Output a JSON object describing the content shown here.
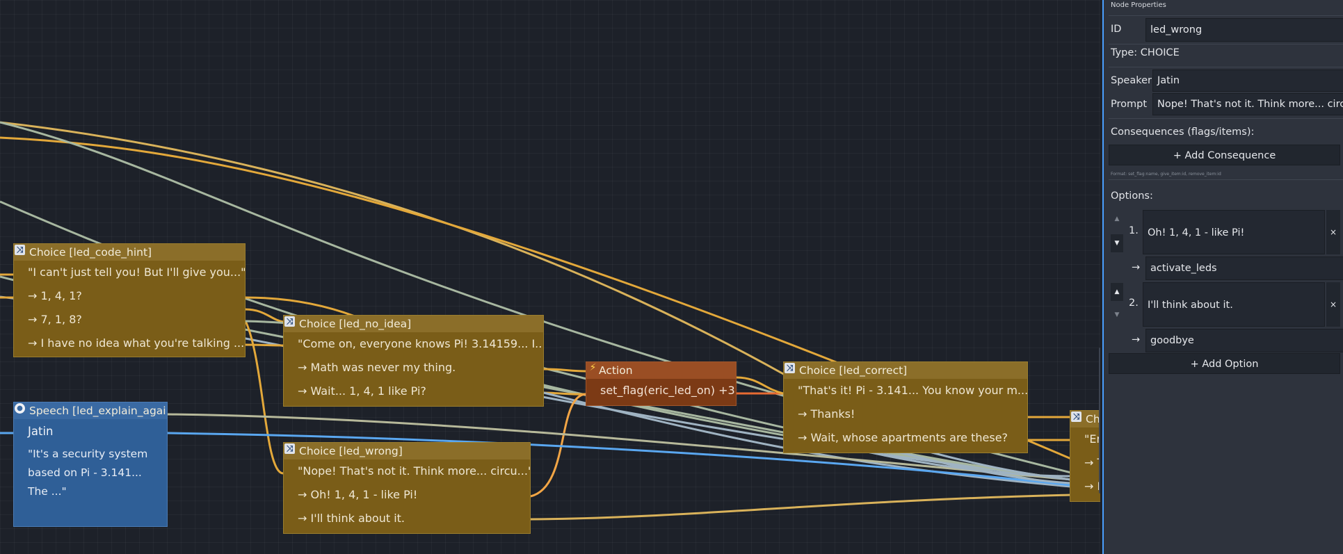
{
  "nodes": {
    "led_code_hint": {
      "title": "Choice [led_code_hint]",
      "prompt": "\"I can't just tell you! But I'll give you...\"",
      "options": [
        "→ 1, 4, 1?",
        "→ 7, 1, 8?",
        "→ I have no idea what you're talking ..."
      ]
    },
    "led_no_idea": {
      "title": "Choice [led_no_idea]",
      "prompt": "\"Come on, everyone knows Pi! 3.14159... I...\"",
      "options": [
        "→ Math was never my thing.",
        "→ Wait... 1, 4, 1 like Pi?"
      ]
    },
    "led_wrong": {
      "title": "Choice [led_wrong]",
      "prompt": "\"Nope! That's not it. Think more... circu...\"",
      "options": [
        "→ Oh! 1, 4, 1 - like Pi!",
        "→ I'll think about it."
      ]
    },
    "action": {
      "title": "Action",
      "body": "set_flag(eric_led_on) +3"
    },
    "led_correct": {
      "title": "Choice [led_correct]",
      "prompt": "\"That's it! Pi - 3.141... You know your m...\"",
      "options": [
        "→ Thanks!",
        "→ Wait, whose apartments are these?"
      ]
    },
    "led_explain_again": {
      "title": "Speech [led_explain_again]",
      "speaker": "Jatin",
      "lines": [
        "\"It's a security system",
        "based on Pi - 3.141...",
        "The ...\""
      ]
    },
    "partial": {
      "title": "Cho",
      "prompt": "\"Er",
      "options": [
        "→ T",
        "→ N"
      ]
    }
  },
  "icons": {
    "choice": "shuffle-icon",
    "action": "lightning-icon",
    "speech": "speech-bubble-icon"
  },
  "colors": {
    "choice": "#7a5d18",
    "action": "#7c3a15",
    "speech": "#2f5f97",
    "accent": "#4a9fff",
    "wire_choice": "#e3a83a",
    "wire_speech": "#5aa7f0",
    "wire_muted": "#a7b7a0"
  },
  "panel": {
    "title": "Node Properties",
    "id_label": "ID",
    "id_value": "led_wrong",
    "type_text": "Type: CHOICE",
    "speaker_label": "Speaker",
    "speaker_value": "Jatin",
    "prompt_label": "Prompt",
    "prompt_value": "Nope! That's not it. Think more... circul",
    "consequences_label": "Consequences (flags/items):",
    "add_consequence": "+ Add Consequence",
    "format_hint": "Format: set_flag:name, give_item:id, remove_item:id",
    "options_label": "Options:",
    "options": [
      {
        "num": "1.",
        "text": "Oh! 1, 4, 1 - like Pi!",
        "target": "activate_leds"
      },
      {
        "num": "2.",
        "text": "I'll think about it.",
        "target": "goodbye"
      }
    ],
    "arrow": "→",
    "remove": "×",
    "up": "▲",
    "down": "▼",
    "add_option": "+ Add Option"
  }
}
